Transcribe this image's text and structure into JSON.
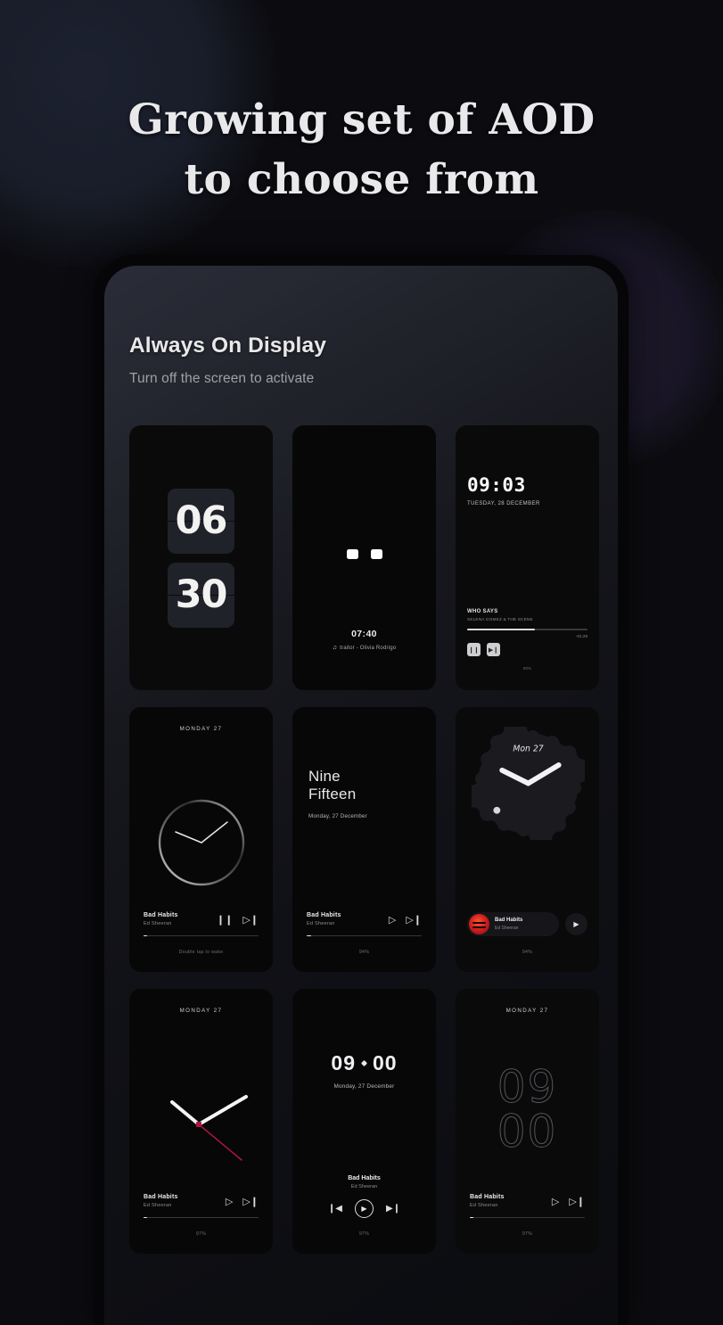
{
  "headline": {
    "line1": "Growing set of AOD",
    "line2": "to choose from"
  },
  "app": {
    "title": "Always On Display",
    "subtitle": "Turn off the screen to activate"
  },
  "colors": {
    "background": "#0c0c10",
    "screen_top": "#2a2d38",
    "accent_red": "#b0153f",
    "text_primary": "#e9e9ec",
    "text_secondary": "#9fa1a7"
  },
  "aods": [
    {
      "id": "flip-clock",
      "hours": "06",
      "minutes": "30"
    },
    {
      "id": "minimal-dots",
      "time": "07:40",
      "track": "traitor - Olivia Rodrigo",
      "note_icon": "music-note-icon"
    },
    {
      "id": "digital-player",
      "time": "09:03",
      "date": "TUESDAY, 28 DECEMBER",
      "song": "WHO SAYS",
      "artist": "SELENA GOMEZ & THE SCENE",
      "remaining": "-01:29",
      "progress": 56,
      "battery": "90%",
      "pause_icon": "pause-icon",
      "next_icon": "next-track-icon"
    },
    {
      "id": "ring-analog",
      "day": "MONDAY 27",
      "song": "Bad Habits",
      "artist": "Ed Sheeran",
      "progress": 3,
      "footer": "Double tap to wake",
      "pause_icon": "pause-icon",
      "next_icon": "next-track-icon"
    },
    {
      "id": "word-clock",
      "hour_word": "Nine",
      "minute_word": "Fifteen",
      "date": "Monday, 27 December",
      "song": "Bad Habits",
      "artist": "Ed Sheeran",
      "progress": 4,
      "battery": "94%",
      "play_icon": "play-icon",
      "next_icon": "next-track-icon"
    },
    {
      "id": "scalloped-analog",
      "day": "Mon 27",
      "song": "Bad Habits",
      "artist": "Ed Sheeran",
      "battery": "94%",
      "play_icon": "play-icon",
      "album_art": "album-art"
    },
    {
      "id": "big-hands",
      "day": "MONDAY 27",
      "song": "Bad Habits",
      "artist": "Ed Sheeran",
      "progress": 3,
      "battery": "97%",
      "play_icon": "play-icon",
      "next_icon": "next-track-icon"
    },
    {
      "id": "centered-digital",
      "hour": "09",
      "minute": "00",
      "date": "Monday, 27 December",
      "song": "Bad Habits",
      "artist": "Ed Sheeran",
      "battery": "97%",
      "prev_icon": "previous-track-icon",
      "play_icon": "play-icon",
      "next_icon": "next-track-icon"
    },
    {
      "id": "outline-digits",
      "day": "MONDAY 27",
      "hour": "09",
      "minute": "00",
      "song": "Bad Habits",
      "artist": "Ed Sheeran",
      "progress": 3,
      "battery": "97%",
      "play_icon": "play-icon",
      "next_icon": "next-track-icon"
    }
  ]
}
